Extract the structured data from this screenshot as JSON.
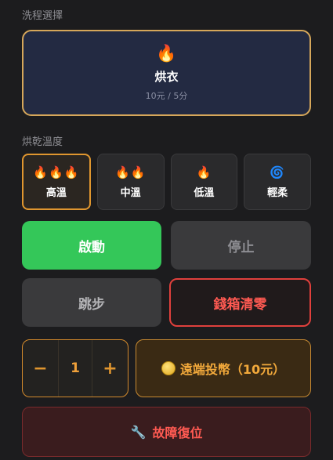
{
  "program": {
    "section_label": "洗程選擇",
    "selected": {
      "icon": "fire-icon",
      "glyph": "🔥",
      "name": "烘衣",
      "price": "10元 / 5分"
    }
  },
  "temperature": {
    "section_label": "烘乾溫度",
    "options": [
      {
        "glyph": "🔥🔥🔥",
        "label": "高溫",
        "active": true
      },
      {
        "glyph": "🔥🔥",
        "label": "中溫",
        "active": false
      },
      {
        "glyph": "🔥",
        "label": "低溫",
        "active": false
      },
      {
        "glyph": "🌀",
        "label": "輕柔",
        "active": false
      }
    ]
  },
  "controls": {
    "start_label": "啟動",
    "stop_label": "停止",
    "skip_label": "跳步",
    "clear_cashbox_label": "錢箱清零"
  },
  "coin": {
    "minus": "−",
    "quantity": "1",
    "plus": "+",
    "remote_coin_label": "遠端投幣（10元）"
  },
  "fault": {
    "glyph": "🔧",
    "label": "故障復位"
  },
  "colors": {
    "accent": "#e0962f",
    "start": "#34c759",
    "danger": "#e0403c",
    "card_bg": "#232a42"
  }
}
